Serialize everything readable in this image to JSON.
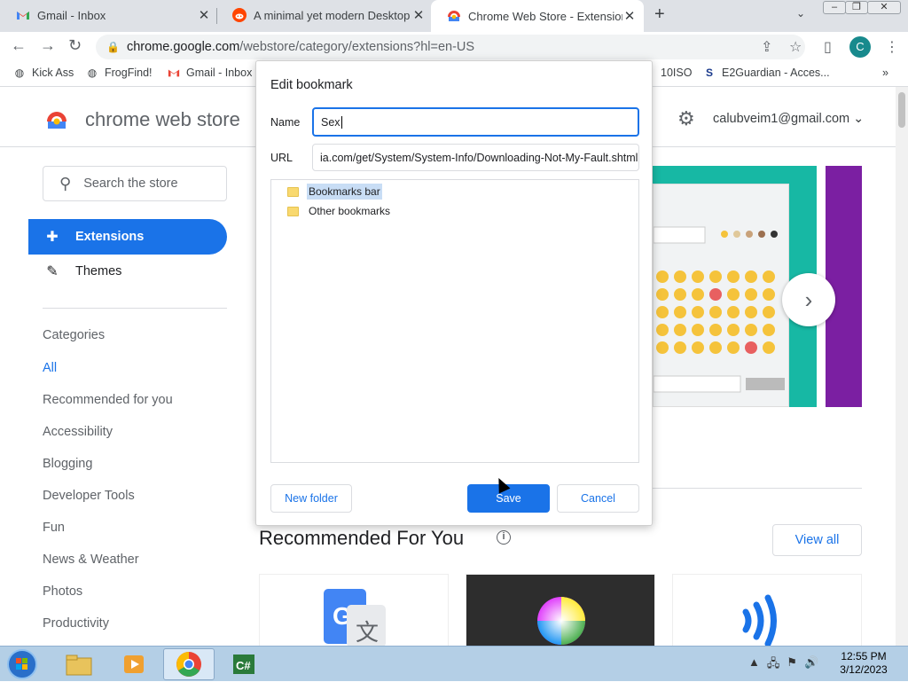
{
  "browser": {
    "tabs": [
      {
        "label": "Gmail - Inbox",
        "icon": "gmail-icon"
      },
      {
        "label": "A minimal yet modern Desktop E",
        "icon": "reddit-icon"
      },
      {
        "label": "Chrome Web Store - Extensions",
        "icon": "chrome-web-store-icon",
        "active": true
      }
    ],
    "new_tab": "+",
    "tab_search": "⌄",
    "address": {
      "host": "chrome.google.com",
      "path": "/webstore/category/extensions?hl=en-US"
    },
    "profile_initial": "C",
    "bookmarks": [
      {
        "label": "Kick Ass",
        "icon": "globe-icon"
      },
      {
        "label": "FrogFind!",
        "icon": "globe-icon"
      },
      {
        "label": "Gmail - Inbox",
        "icon": "gmail-icon"
      },
      {
        "label": "10ISO",
        "icon": "globe-icon"
      },
      {
        "label": "E2Guardian - Acces...",
        "icon": "s-icon"
      }
    ],
    "bookmarks_overflow": "»"
  },
  "store": {
    "title": "chrome web store",
    "account": "calubveim1@gmail.com",
    "search_placeholder": "Search the store",
    "nav": [
      {
        "label": "Extensions",
        "icon": "puzzle-icon",
        "active": true
      },
      {
        "label": "Themes",
        "icon": "brush-icon",
        "active": false
      }
    ],
    "categories_heading": "Categories",
    "categories": [
      "All",
      "Recommended for you",
      "Accessibility",
      "Blogging",
      "Developer Tools",
      "Fun",
      "News & Weather",
      "Photos",
      "Productivity"
    ],
    "selected_category": "All",
    "recommended_title": "Recommended For You",
    "view_all": "View all"
  },
  "dialog": {
    "title": "Edit bookmark",
    "name_label": "Name",
    "name_value": "Sex",
    "url_label": "URL",
    "url_value": "ia.com/get/System/System-Info/Downloading-Not-My-Fault.shtml",
    "folders": [
      "Bookmarks bar",
      "Other bookmarks"
    ],
    "selected_folder": "Bookmarks bar",
    "new_folder": "New folder",
    "save": "Save",
    "cancel": "Cancel"
  },
  "taskbar": {
    "time": "12:55 PM",
    "date": "3/12/2023"
  },
  "colors": {
    "accent": "#1a73e8",
    "banner": "#17b8a4",
    "banner_alt": "#7b1fa2",
    "profile": "#188a8d"
  }
}
